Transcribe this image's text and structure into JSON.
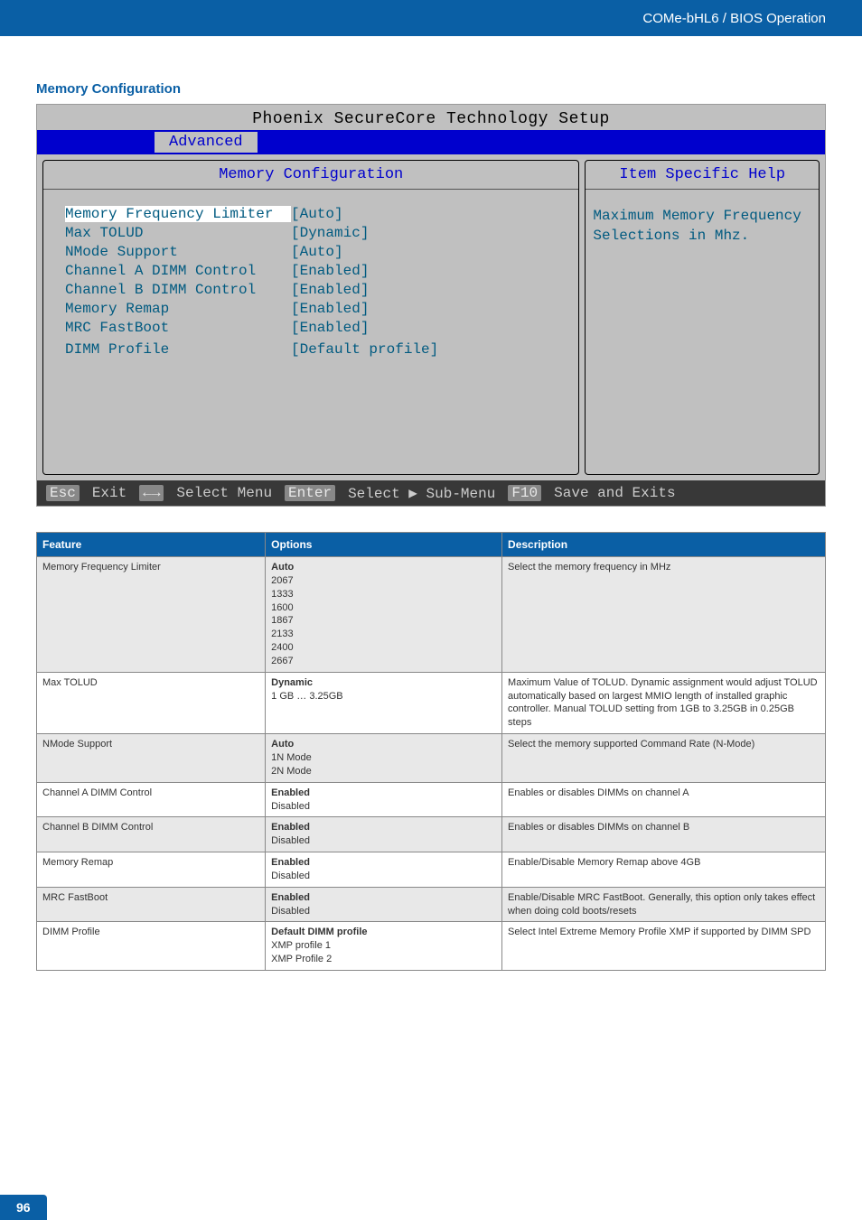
{
  "header": {
    "breadcrumb": "COMe-bHL6 / BIOS Operation"
  },
  "section_title": "Memory Configuration",
  "bios": {
    "title": "Phoenix SecureCore Technology Setup",
    "active_tab": "Advanced",
    "left_pane_title": "Memory Configuration",
    "right_pane_title": "Item Specific Help",
    "help_text": "Maximum Memory Frequency Selections in Mhz.",
    "settings": [
      {
        "label": "Memory Frequency Limiter",
        "value": "[Auto]",
        "highlight": true
      },
      {
        "label": "Max TOLUD",
        "value": "[Dynamic]"
      },
      {
        "label": "NMode Support",
        "value": "[Auto]"
      },
      {
        "label": "Channel A DIMM Control",
        "value": "[Enabled]"
      },
      {
        "label": "Channel B DIMM Control",
        "value": "[Enabled]"
      },
      {
        "label": "Memory Remap",
        "value": "[Enabled]"
      },
      {
        "label": "MRC FastBoot",
        "value": "[Enabled]"
      },
      {
        "label": " ",
        "value": " "
      },
      {
        "label": "DIMM Profile",
        "value": "[Default profile]"
      }
    ],
    "footer": {
      "k1": "Esc",
      "a1": "Exit",
      "k2": "←→",
      "a2": "Select Menu",
      "k3": "Enter",
      "a3": "Select ▶ Sub-Menu",
      "k4": "F10",
      "a4": "Save and Exits"
    }
  },
  "table": {
    "headers": {
      "feature": "Feature",
      "options": "Options",
      "description": "Description"
    },
    "rows": [
      {
        "feature": "Memory Frequency Limiter",
        "options": [
          {
            "text": "Auto",
            "bold": true
          },
          {
            "text": "2067"
          },
          {
            "text": "1333"
          },
          {
            "text": "1600"
          },
          {
            "text": "1867"
          },
          {
            "text": "2133"
          },
          {
            "text": "2400"
          },
          {
            "text": "2667"
          }
        ],
        "description": "Select the memory frequency in MHz"
      },
      {
        "feature": "Max TOLUD",
        "options": [
          {
            "text": "Dynamic",
            "bold": true
          },
          {
            "text": "1 GB … 3.25GB"
          }
        ],
        "description": "Maximum Value of TOLUD. Dynamic assignment would adjust TOLUD automatically based on largest MMIO length of installed graphic controller. Manual TOLUD setting from 1GB to 3.25GB in 0.25GB steps"
      },
      {
        "feature": "NMode Support",
        "options": [
          {
            "text": "Auto",
            "bold": true
          },
          {
            "text": "1N Mode"
          },
          {
            "text": "2N Mode"
          }
        ],
        "description": "Select the memory supported Command Rate (N-Mode)"
      },
      {
        "feature": "Channel A DIMM Control",
        "options": [
          {
            "text": "Enabled",
            "bold": true
          },
          {
            "text": "Disabled"
          }
        ],
        "description": "Enables or disables DIMMs on channel A"
      },
      {
        "feature": "Channel B DIMM Control",
        "options": [
          {
            "text": "Enabled",
            "bold": true
          },
          {
            "text": "Disabled"
          }
        ],
        "description": "Enables or disables DIMMs on channel B"
      },
      {
        "feature": "Memory Remap",
        "options": [
          {
            "text": "Enabled",
            "bold": true
          },
          {
            "text": "Disabled"
          }
        ],
        "description": "Enable/Disable Memory Remap above 4GB"
      },
      {
        "feature": "MRC FastBoot",
        "options": [
          {
            "text": "Enabled",
            "bold": true
          },
          {
            "text": "Disabled"
          }
        ],
        "description": "Enable/Disable MRC FastBoot. Generally, this option only takes effect when doing cold boots/resets"
      },
      {
        "feature": "DIMM Profile",
        "options": [
          {
            "text": "Default DIMM profile",
            "bold": true
          },
          {
            "text": "XMP profile 1"
          },
          {
            "text": "XMP Profile 2"
          }
        ],
        "description": "Select Intel Extreme Memory Profile XMP if supported by DIMM SPD"
      }
    ]
  },
  "page_number": "96"
}
